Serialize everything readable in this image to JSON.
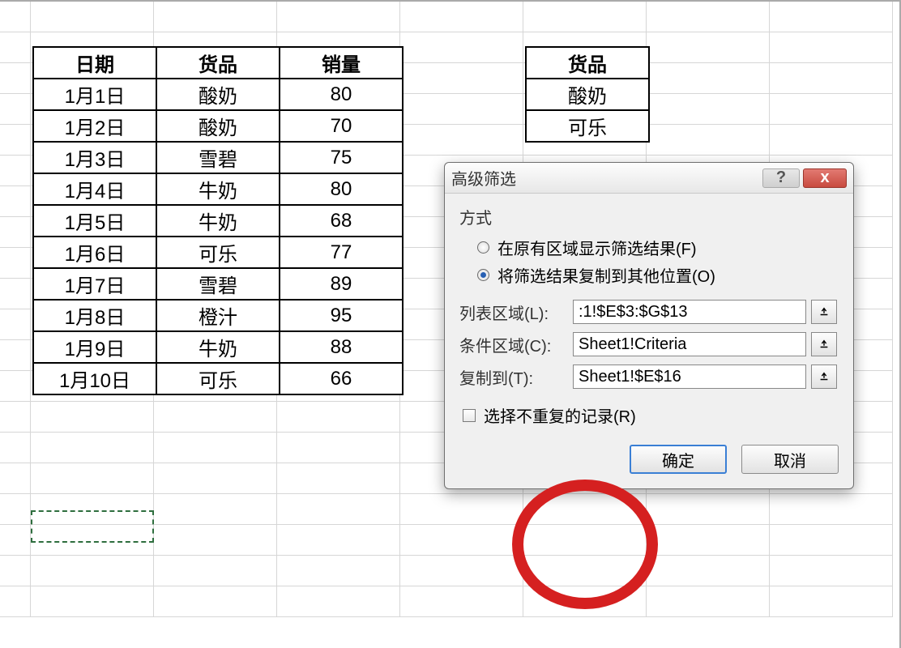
{
  "table": {
    "headers": [
      "日期",
      "货品",
      "销量"
    ],
    "rows": [
      [
        "1月1日",
        "酸奶",
        "80"
      ],
      [
        "1月2日",
        "酸奶",
        "70"
      ],
      [
        "1月3日",
        "雪碧",
        "75"
      ],
      [
        "1月4日",
        "牛奶",
        "80"
      ],
      [
        "1月5日",
        "牛奶",
        "68"
      ],
      [
        "1月6日",
        "可乐",
        "77"
      ],
      [
        "1月7日",
        "雪碧",
        "89"
      ],
      [
        "1月8日",
        "橙汁",
        "95"
      ],
      [
        "1月9日",
        "牛奶",
        "88"
      ],
      [
        "1月10日",
        "可乐",
        "66"
      ]
    ]
  },
  "criteria": {
    "header": "货品",
    "rows": [
      "酸奶",
      "可乐"
    ]
  },
  "dialog": {
    "title": "高级筛选",
    "group_label": "方式",
    "radio1": "在原有区域显示筛选结果(F)",
    "radio2": "将筛选结果复制到其他位置(O)",
    "label_list": "列表区域(L):",
    "label_criteria": "条件区域(C):",
    "label_copyto": "复制到(T):",
    "val_list": ":1!$E$3:$G$13",
    "val_criteria": "Sheet1!Criteria",
    "val_copyto": "Sheet1!$E$16",
    "checkbox": "选择不重复的记录(R)",
    "ok": "确定",
    "cancel": "取消"
  },
  "icons": {
    "help": "?",
    "close": "x"
  }
}
